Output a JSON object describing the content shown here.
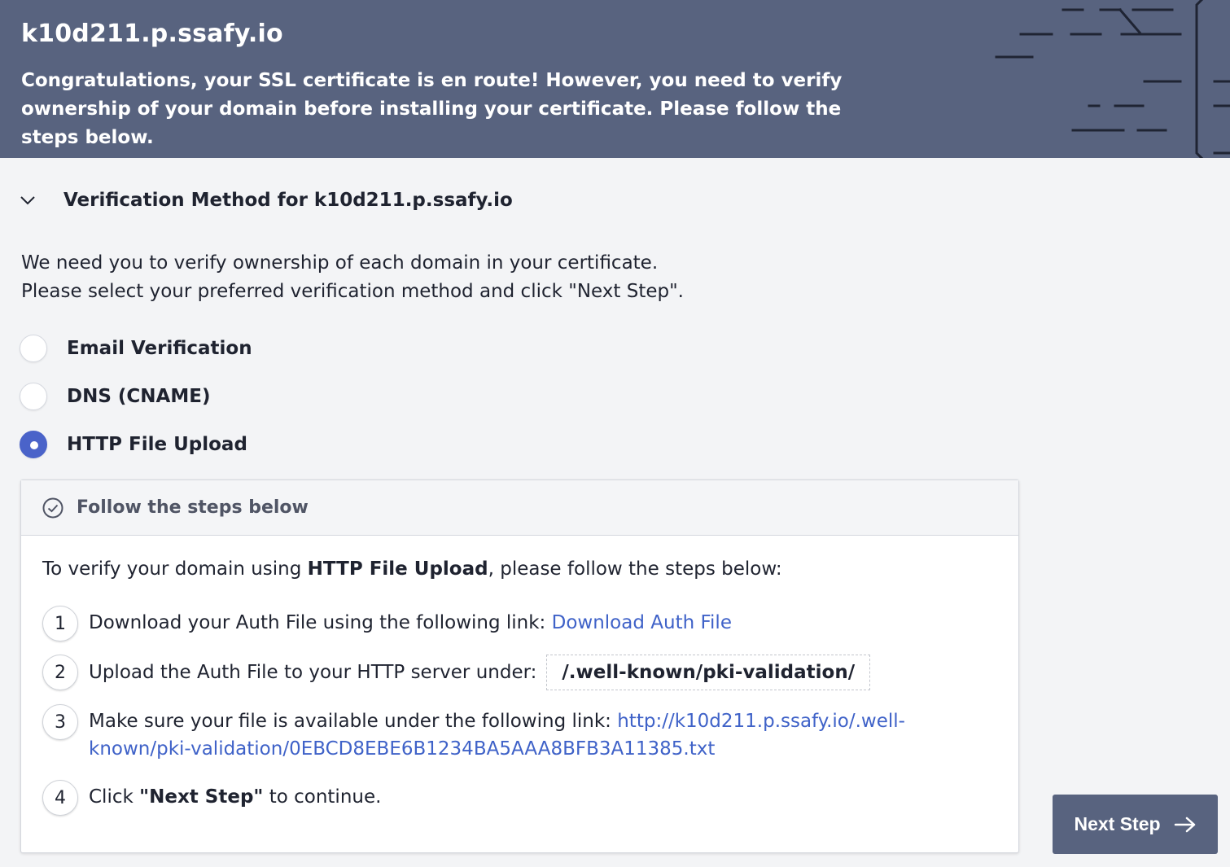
{
  "header": {
    "domain": "k10d211.p.ssafy.io",
    "message": "Congratulations, your SSL certificate is en route! However, you need to verify ownership of your domain before installing your certificate. Please follow the steps below."
  },
  "section": {
    "title": "Verification Method for k10d211.p.ssafy.io",
    "intro_line1": "We need you to verify ownership of each domain in your certificate.",
    "intro_line2": "Please select your preferred verification method and click \"Next Step\"."
  },
  "options": [
    {
      "label": "Email Verification",
      "selected": false
    },
    {
      "label": "DNS (CNAME)",
      "selected": false
    },
    {
      "label": "HTTP File Upload",
      "selected": true
    }
  ],
  "panel": {
    "heading": "Follow the steps below",
    "lead_pre": "To verify your domain using ",
    "lead_bold": "HTTP File Upload",
    "lead_post": ", please follow the steps below:",
    "steps": [
      {
        "num": "1",
        "text": "Download your Auth File using the following link: ",
        "link": "Download Auth File"
      },
      {
        "num": "2",
        "text": "Upload the Auth File to your HTTP server under:",
        "path": "/.well-known/pki-validation/"
      },
      {
        "num": "3",
        "text": "Make sure your file is available under the following link: ",
        "link_part1": "http://k10d211.p.ssafy.io/.well-",
        "link_part2": "known/pki-validation/0EBCD8EBE6B1234BA5AAA8BFB3A11385.txt"
      },
      {
        "num": "4",
        "text_pre": "Click ",
        "text_bold": "\"Next Step\"",
        "text_post": " to continue."
      }
    ]
  },
  "next_button": {
    "label": "Next Step"
  },
  "colors": {
    "header_bg": "#58637f",
    "accent": "#4a63c9",
    "link": "#3f62c8"
  }
}
